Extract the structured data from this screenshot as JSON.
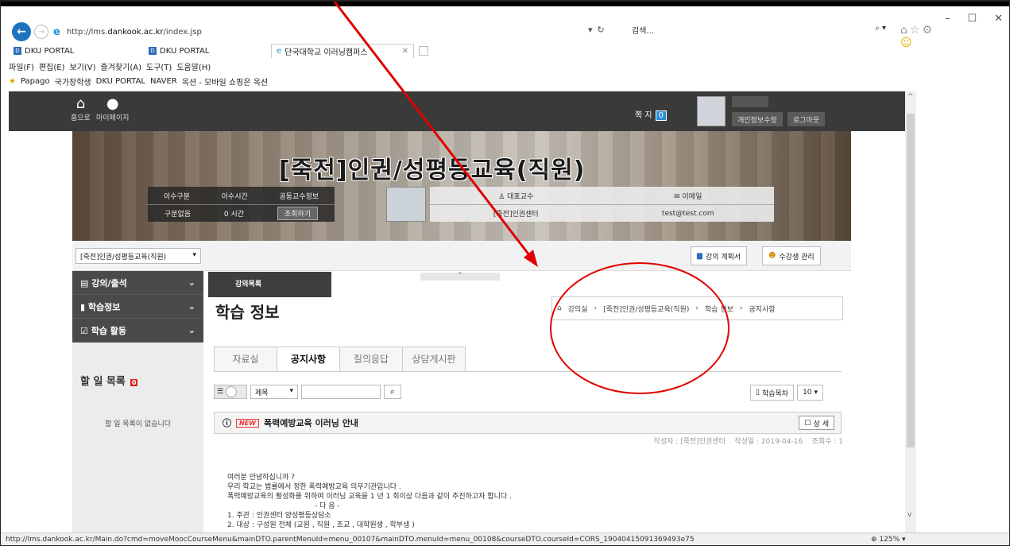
{
  "browser": {
    "url_prefix": "http://lms.",
    "url_domain": "dankook.ac.kr",
    "url_path": "/index.jsp",
    "search_placeholder": "검색...",
    "tabs": [
      {
        "label": "DKU PORTAL"
      },
      {
        "label": "DKU PORTAL"
      },
      {
        "label": "단국대학교 이러닝캠퍼스"
      }
    ],
    "menu": [
      "파일(F)",
      "편집(E)",
      "보기(V)",
      "즐겨찾기(A)",
      "도구(T)",
      "도움말(H)"
    ],
    "favorites": [
      "Papago",
      "국가장학생",
      "DKU PORTAL",
      "NAVER",
      "옥션 - 모바일 쇼핑은 옥션"
    ],
    "status_url": "http://lms.dankook.ac.kr/Main.do?cmd=moveMoocCourseMenu&mainDTO.parentMenuId=menu_00107&mainDTO.menuId=menu_00108&courseDTO.courseId=CORS_19040415091369493e75",
    "zoom": "125%"
  },
  "topbar": {
    "home": "홈으로",
    "mypage": "마이페이지",
    "note": "쪽 지",
    "note_count": "0",
    "edit_profile": "개인정보수정",
    "logout": "로그아웃"
  },
  "banner": {
    "title": "[죽전]인권/성평등교육(직원)",
    "info_h1": "이수구분",
    "info_h2": "이수시간",
    "info_h3": "공동교수정보",
    "info_v1": "구분없음",
    "info_v2": "0 시간",
    "info_btn": "조회하기",
    "prof_label": "대표교수",
    "email_label": "이메일",
    "prof_name": "[죽전]인권센터",
    "email": "test@test.com"
  },
  "subbar": {
    "course_select": "[죽전]인권/성평등교육(직원)",
    "plan_btn": "강의 계획서",
    "students_btn": "수강생 관리"
  },
  "sidebar": {
    "items": [
      {
        "label": "강의/출석"
      },
      {
        "label": "학습정보"
      },
      {
        "label": "학습 활동"
      }
    ],
    "todo_title": "할 일 목록",
    "todo_count": "0",
    "todo_empty": "할 일 목록이 없습니다"
  },
  "main": {
    "dropnav": "강의목록",
    "page_title": "학습 정보",
    "breadcrumb": [
      "강의실",
      "[죽전]인권/성평등교육(직원)",
      "학습 정보",
      "공지사항"
    ],
    "tabs": [
      "자료실",
      "공지사항",
      "질의응답",
      "상담게시판"
    ],
    "search_field": "제목",
    "toc_btn": "학습목차",
    "page_size": "10",
    "post": {
      "badge": "NEW",
      "title": "폭력예방교육 이러닝 안내",
      "detail_btn": "상 세",
      "author_label": "작성자 : [죽전]인권센터",
      "date_label": "작성일 : 2019-04-16",
      "views_label": "조회수 : 1",
      "body": [
        "여러분 안녕하십니까 ?",
        "우리 학교는 법률에서 정한 폭력예방교육 의무기관입니다 .",
        "폭력예방교육의 활성화를 위하여 이러닝 교육을 1 년 1 회이상 다음과 같이 추진하고자 합니다 .",
        "- 다    음 -",
        "1. 주관 : 인권센터 양성평등상담소",
        "2. 대상 : 구성원 전체 (교원 , 직원 , 조교 , 대학원생 , 학부생 )"
      ]
    }
  },
  "colors": {
    "annotation": "#e00000"
  }
}
